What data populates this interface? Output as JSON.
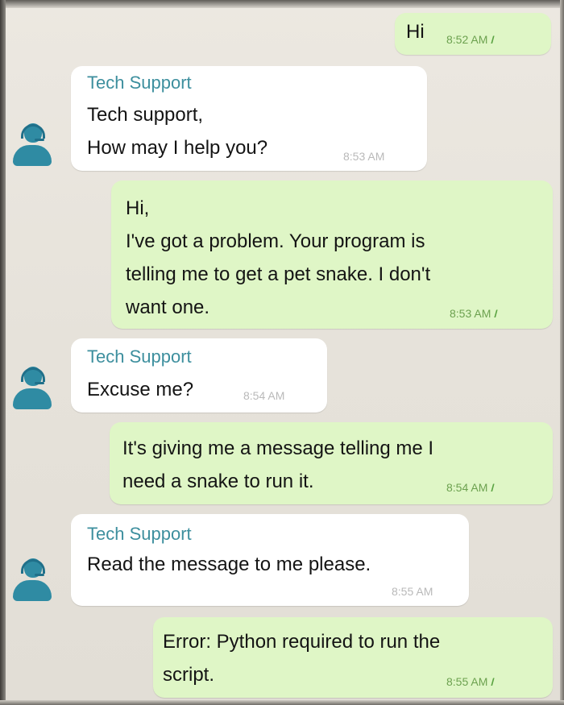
{
  "colors": {
    "outgoing_bubble": "#dff6c6",
    "incoming_bubble": "#ffffff",
    "sender_name": "#3d8f9e",
    "avatar": "#2f8ba3"
  },
  "icons": {
    "avatar": "support-agent-icon",
    "delivered": "double-check-icon"
  },
  "messages": [
    {
      "direction": "outgoing",
      "lines": [
        "Hi"
      ],
      "time": "8:52 AM",
      "ticks": "//"
    },
    {
      "direction": "incoming",
      "sender": "Tech Support",
      "lines": [
        "Tech support,",
        "How may I help you?"
      ],
      "time": "8:53 AM"
    },
    {
      "direction": "outgoing",
      "lines": [
        "Hi,",
        "I've got a problem. Your program is",
        "telling me to get a pet snake. I don't",
        "want one."
      ],
      "time": "8:53 AM",
      "ticks": "//"
    },
    {
      "direction": "incoming",
      "sender": "Tech Support",
      "lines": [
        "Excuse me?"
      ],
      "time": "8:54 AM"
    },
    {
      "direction": "outgoing",
      "lines": [
        "It's giving me a message telling me I",
        "need a snake to run it."
      ],
      "time": "8:54 AM",
      "ticks": "//"
    },
    {
      "direction": "incoming",
      "sender": "Tech Support",
      "lines": [
        "Read the message to me please."
      ],
      "time": "8:55 AM"
    },
    {
      "direction": "outgoing",
      "lines": [
        "Error: Python required to run the",
        "script."
      ],
      "time": "8:55 AM",
      "ticks": "//"
    }
  ]
}
